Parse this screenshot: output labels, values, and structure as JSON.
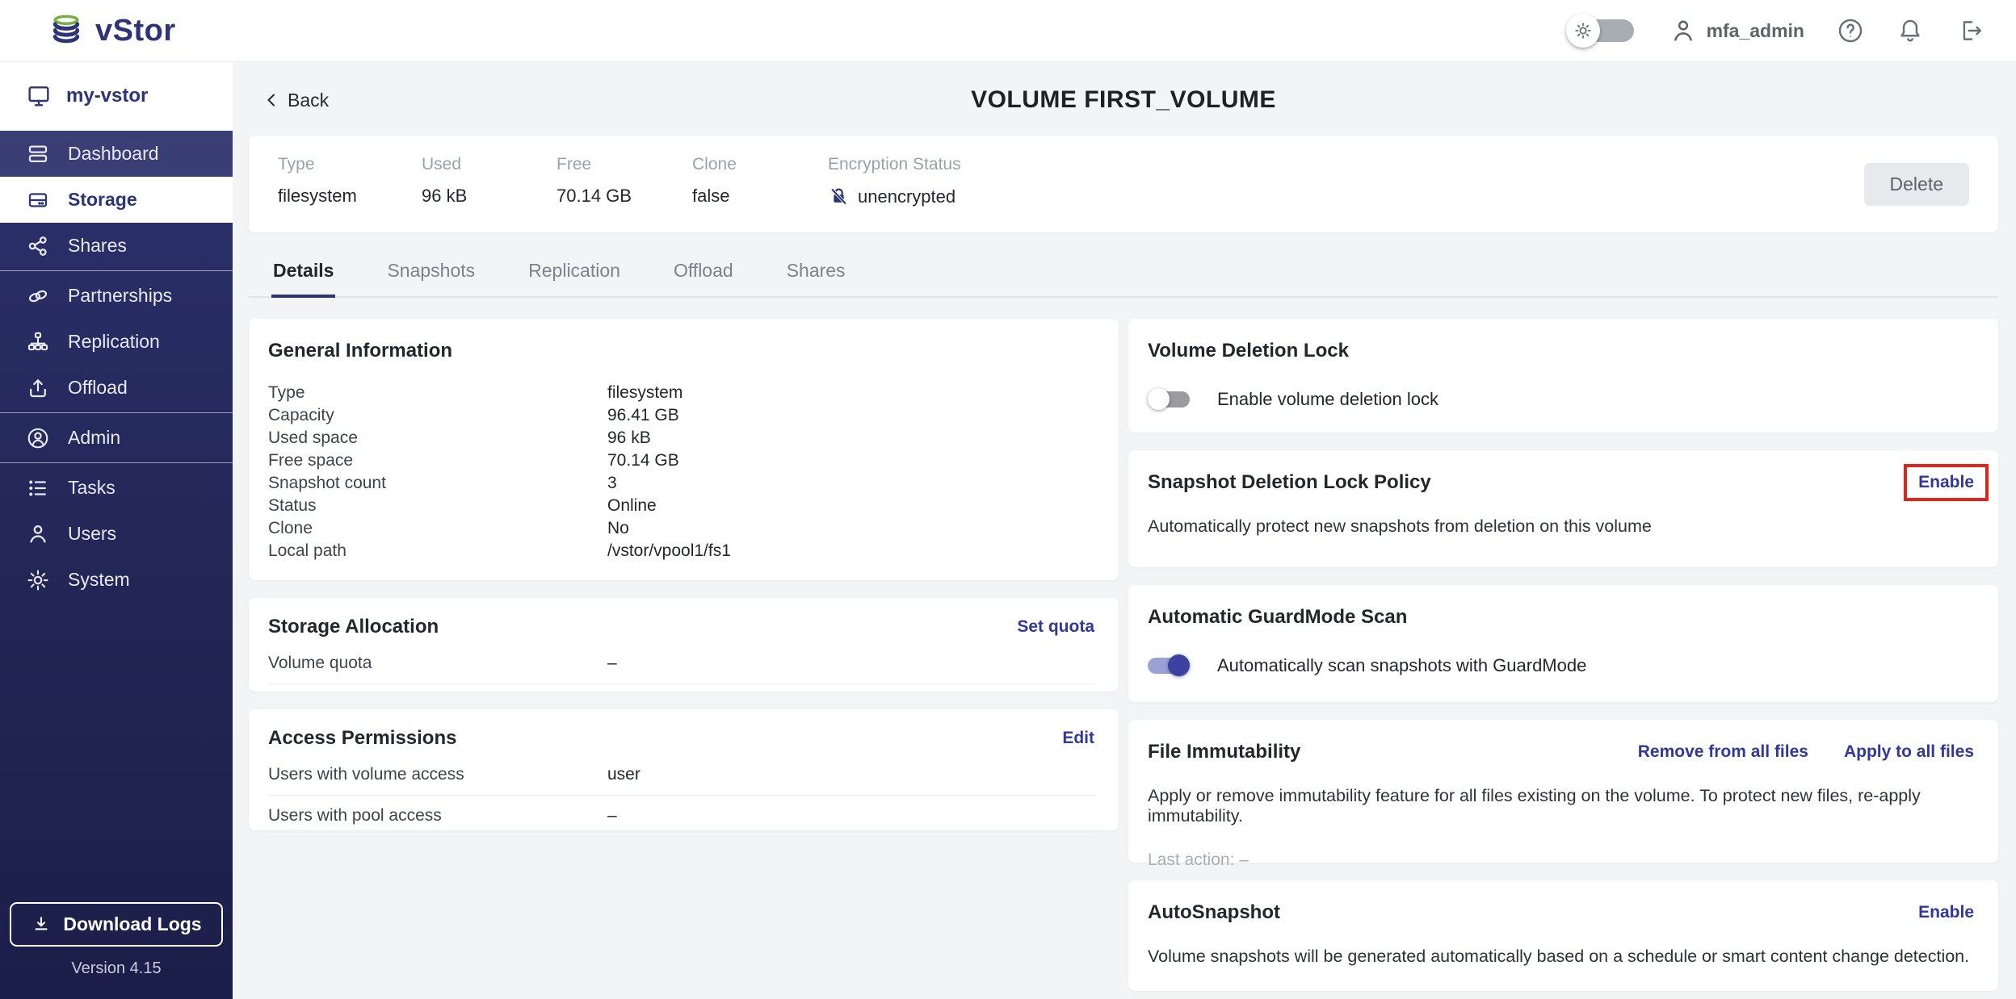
{
  "header": {
    "logo_text": "vStor",
    "username": "mfa_admin"
  },
  "sidebar": {
    "hostname": "my-vstor",
    "items": [
      {
        "label": "Dashboard"
      },
      {
        "label": "Storage"
      },
      {
        "label": "Shares"
      },
      {
        "label": "Partnerships"
      },
      {
        "label": "Replication"
      },
      {
        "label": "Offload"
      },
      {
        "label": "Admin"
      },
      {
        "label": "Tasks"
      },
      {
        "label": "Users"
      },
      {
        "label": "System"
      }
    ],
    "download_logs_label": "Download Logs",
    "version": "Version 4.15"
  },
  "page": {
    "back_label": "Back",
    "title": "VOLUME FIRST_VOLUME"
  },
  "summary": {
    "fields": [
      {
        "label": "Type",
        "value": "filesystem"
      },
      {
        "label": "Used",
        "value": "96 kB"
      },
      {
        "label": "Free",
        "value": "70.14 GB"
      },
      {
        "label": "Clone",
        "value": "false"
      },
      {
        "label": "Encryption Status",
        "value": "unencrypted"
      }
    ],
    "delete_label": "Delete"
  },
  "tabs": [
    {
      "label": "Details"
    },
    {
      "label": "Snapshots"
    },
    {
      "label": "Replication"
    },
    {
      "label": "Offload"
    },
    {
      "label": "Shares"
    }
  ],
  "general_information": {
    "title": "General Information",
    "rows": [
      {
        "label": "Type",
        "value": "filesystem"
      },
      {
        "label": "Capacity",
        "value": "96.41 GB"
      },
      {
        "label": "Used space",
        "value": "96 kB"
      },
      {
        "label": "Free space",
        "value": "70.14 GB"
      },
      {
        "label": "Snapshot count",
        "value": "3"
      },
      {
        "label": "Status",
        "value": "Online"
      },
      {
        "label": "Clone",
        "value": "No"
      },
      {
        "label": "Local path",
        "value": "/vstor/vpool1/fs1"
      }
    ]
  },
  "storage_allocation": {
    "title": "Storage Allocation",
    "action_label": "Set quota",
    "rows": [
      {
        "label": "Volume quota",
        "value": "–"
      }
    ]
  },
  "access_permissions": {
    "title": "Access Permissions",
    "action_label": "Edit",
    "rows": [
      {
        "label": "Users with volume access",
        "value": "user"
      },
      {
        "label": "Users with pool access",
        "value": "–"
      }
    ]
  },
  "volume_deletion_lock": {
    "title": "Volume Deletion Lock",
    "toggle_label": "Enable volume deletion lock",
    "toggle_state": "off"
  },
  "snapshot_deletion_lock_policy": {
    "title": "Snapshot Deletion Lock Policy",
    "action_label": "Enable",
    "description": "Automatically protect new snapshots from deletion on this volume"
  },
  "automatic_guardmode_scan": {
    "title": "Automatic GuardMode Scan",
    "toggle_label": "Automatically scan snapshots with GuardMode",
    "toggle_state": "on"
  },
  "file_immutability": {
    "title": "File Immutability",
    "action_remove_label": "Remove from all files",
    "action_apply_label": "Apply to all files",
    "description": "Apply or remove immutability feature for all files existing on the volume. To protect new files, re-apply immutability.",
    "last_action": "Last action: –"
  },
  "autosnapshot": {
    "title": "AutoSnapshot",
    "action_label": "Enable",
    "description": "Volume snapshots will be generated automatically based on a schedule or smart content change detection."
  },
  "colors": {
    "brand_navy": "#2d3478",
    "link_blue": "#31379b",
    "logo_green": "#76b043",
    "highlight_red": "#e2231a"
  }
}
